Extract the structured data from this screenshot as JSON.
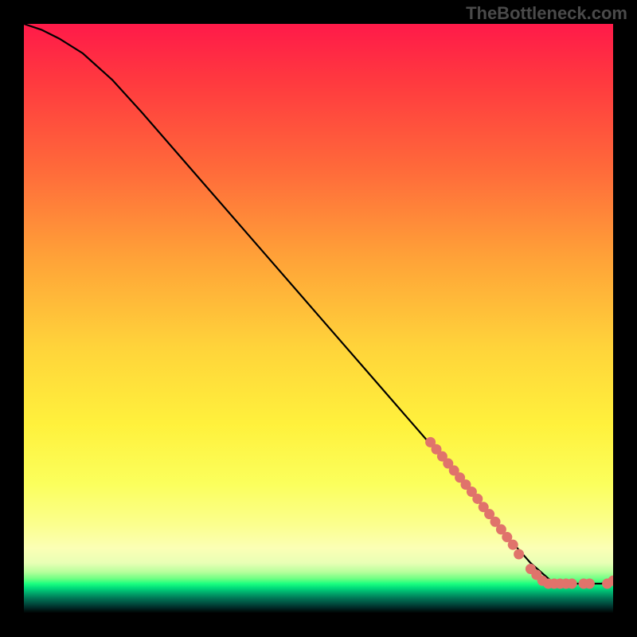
{
  "watermark": "TheBottleneck.com",
  "chart_data": {
    "type": "line",
    "title": "",
    "xlabel": "",
    "ylabel": "",
    "xlim": [
      0,
      100
    ],
    "ylim": [
      0,
      100
    ],
    "curve": {
      "name": "bottleneck-curve",
      "x": [
        0,
        3,
        6,
        10,
        15,
        20,
        30,
        40,
        50,
        60,
        70,
        78,
        82,
        86,
        90,
        94,
        98,
        100
      ],
      "y": [
        100,
        99,
        97.5,
        95,
        90.5,
        85,
        73.5,
        62,
        50.5,
        39,
        27.5,
        18,
        13,
        8.5,
        5,
        5,
        5,
        5.5
      ]
    },
    "points": {
      "name": "benchmark-points",
      "x": [
        69,
        70,
        71,
        72,
        73,
        74,
        75,
        76,
        77,
        78,
        79,
        80,
        81,
        82,
        83,
        84,
        86,
        87,
        88,
        89,
        90,
        91,
        92,
        93,
        95,
        96,
        99,
        100
      ],
      "y": [
        29,
        27.8,
        26.6,
        25.4,
        24.2,
        23,
        21.8,
        20.6,
        19.4,
        18,
        16.8,
        15.5,
        14.2,
        12.9,
        11.6,
        10,
        7.5,
        6.5,
        5.5,
        5,
        5,
        5,
        5,
        5,
        5,
        5,
        5,
        5.5
      ]
    }
  }
}
